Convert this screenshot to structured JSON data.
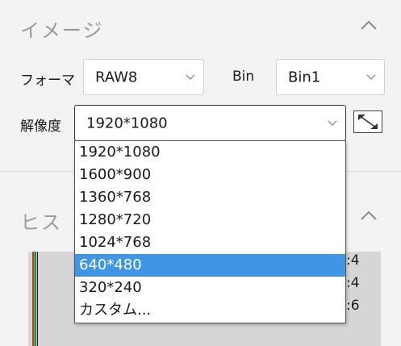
{
  "image_section": {
    "title": "イメージ",
    "format_label": "フォーマ",
    "format_value": "RAW8",
    "bin_label": "Bin",
    "bin_value": "Bin1",
    "resolution_label": "解像度",
    "resolution_value": "1920*1080"
  },
  "resolution_options": [
    "1920*1080",
    "1600*900",
    "1360*768",
    "1280*720",
    "1024*768",
    "640*480",
    "320*240",
    "カスタム..."
  ],
  "highlighted_option": "640*480",
  "histogram_section": {
    "title": "ヒス",
    "side_values": [
      ":4",
      ":4",
      ":6"
    ]
  },
  "colors": {
    "highlight": "#3f95e6",
    "background": "#f3f3f3"
  }
}
